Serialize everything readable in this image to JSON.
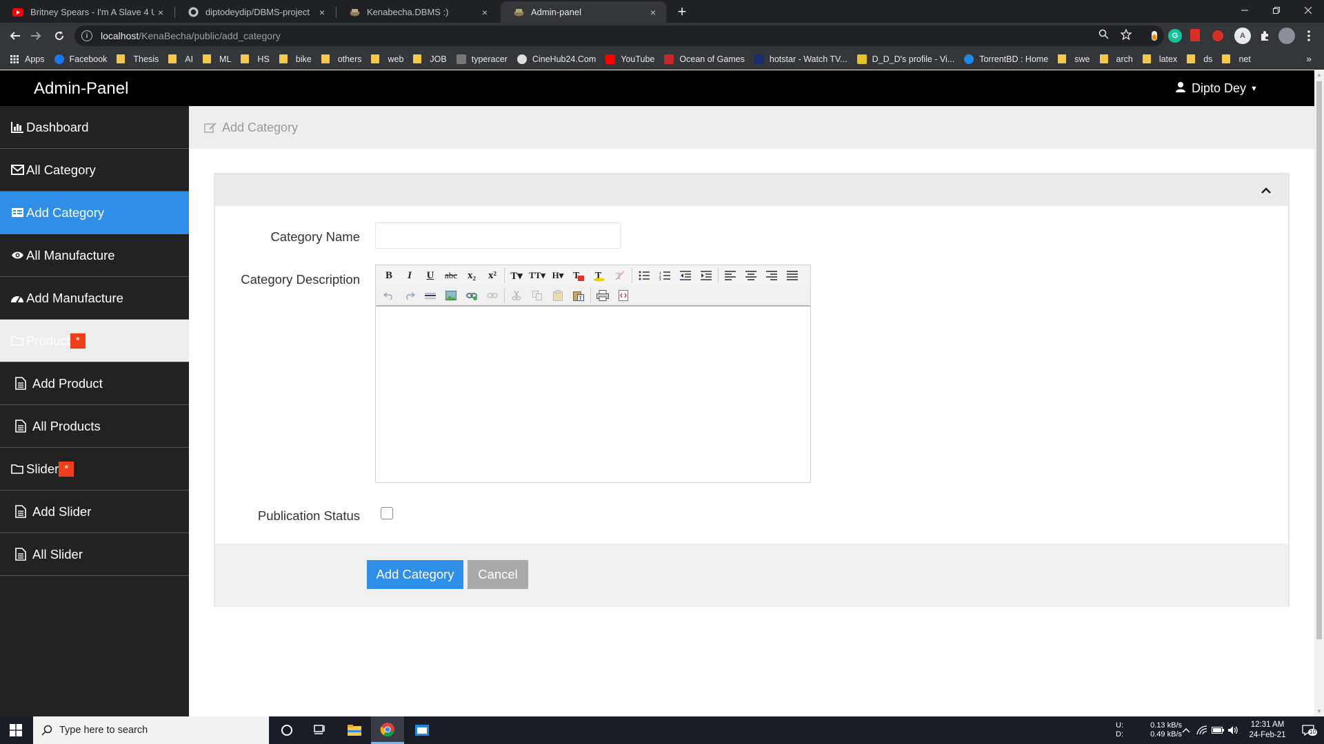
{
  "browser": {
    "tabs": [
      {
        "title": "Britney Spears - I'm A Slave 4 U",
        "favicon": "youtube-icon"
      },
      {
        "title": "diptodeydip/DBMS-project",
        "favicon": "github-icon"
      },
      {
        "title": "Kenabecha.DBMS :)",
        "favicon": "site-icon"
      },
      {
        "title": "Admin-panel",
        "favicon": "site-icon"
      }
    ],
    "close_glyph": "×",
    "new_tab_glyph": "+",
    "url_host": "localhost",
    "url_path": "/KenaBecha/public/add_category",
    "bookmarks": [
      {
        "label": "Apps",
        "icon": "apps-icon"
      },
      {
        "label": "Facebook",
        "icon": "facebook-icon"
      },
      {
        "label": "Thesis",
        "icon": "folder-icon"
      },
      {
        "label": "AI",
        "icon": "folder-icon"
      },
      {
        "label": "ML",
        "icon": "folder-icon"
      },
      {
        "label": "HS",
        "icon": "folder-icon"
      },
      {
        "label": "bike",
        "icon": "folder-icon"
      },
      {
        "label": "others",
        "icon": "folder-icon"
      },
      {
        "label": "web",
        "icon": "folder-icon"
      },
      {
        "label": "JOB",
        "icon": "folder-icon"
      },
      {
        "label": "typeracer",
        "icon": "typeracer-icon"
      },
      {
        "label": "CineHub24.Com",
        "icon": "cinehub-icon"
      },
      {
        "label": "YouTube",
        "icon": "youtube-icon"
      },
      {
        "label": "Ocean of Games",
        "icon": "game-icon"
      },
      {
        "label": "hotstar - Watch TV...",
        "icon": "hotstar-icon"
      },
      {
        "label": "D_D_D's profile - Vi...",
        "icon": "profile-icon"
      },
      {
        "label": "TorrentBD : Home",
        "icon": "torrent-icon"
      },
      {
        "label": "swe",
        "icon": "folder-icon"
      },
      {
        "label": "arch",
        "icon": "folder-icon"
      },
      {
        "label": "latex",
        "icon": "folder-icon"
      },
      {
        "label": "ds",
        "icon": "folder-icon"
      },
      {
        "label": "net",
        "icon": "folder-icon"
      }
    ],
    "more_glyph": "»"
  },
  "app": {
    "brand": "Admin-Panel",
    "user_name": "Dipto Dey"
  },
  "sidebar": {
    "items": [
      {
        "label": "Dashboard",
        "icon": "bar-chart-icon"
      },
      {
        "label": "All Category",
        "icon": "envelope-icon"
      },
      {
        "label": "Add Category",
        "icon": "list-icon",
        "active": true
      },
      {
        "label": "All Manufacture",
        "icon": "eye-icon"
      },
      {
        "label": "Add Manufacture",
        "icon": "dashboard-icon"
      },
      {
        "label": "Product",
        "icon": "folder-icon",
        "badge": "*"
      },
      {
        "label": "Add Product",
        "icon": "file-icon"
      },
      {
        "label": "All Products",
        "icon": "file-icon"
      },
      {
        "label": "Slider",
        "icon": "folder-icon",
        "badge": "*"
      },
      {
        "label": "Add Slider",
        "icon": "file-icon"
      },
      {
        "label": "All Slider",
        "icon": "file-icon"
      }
    ]
  },
  "main": {
    "breadcrumb": "Add Category",
    "form": {
      "name_label": "Category Name",
      "name_value": "",
      "description_label": "Category Description",
      "status_label": "Publication Status",
      "status_checked": false,
      "submit_label": "Add Category",
      "cancel_label": "Cancel"
    },
    "editor_toolbar_row1": [
      "B",
      "I",
      "U",
      "abc",
      "x₂",
      "x²",
      "T▾",
      "TT▾",
      "H▾"
    ],
    "colors": {
      "accent": "#2f8ee8",
      "badge": "#ef3f1a",
      "cancel": "#a9a9a9"
    }
  },
  "taskbar": {
    "search_placeholder": "Type here to search",
    "net_up_label": "U:",
    "net_down_label": "D:",
    "net_up": "0.13 kB/s",
    "net_down": "0.49 kB/s",
    "time": "12:31 AM",
    "date": "24-Feb-21",
    "notification_count": "10"
  }
}
